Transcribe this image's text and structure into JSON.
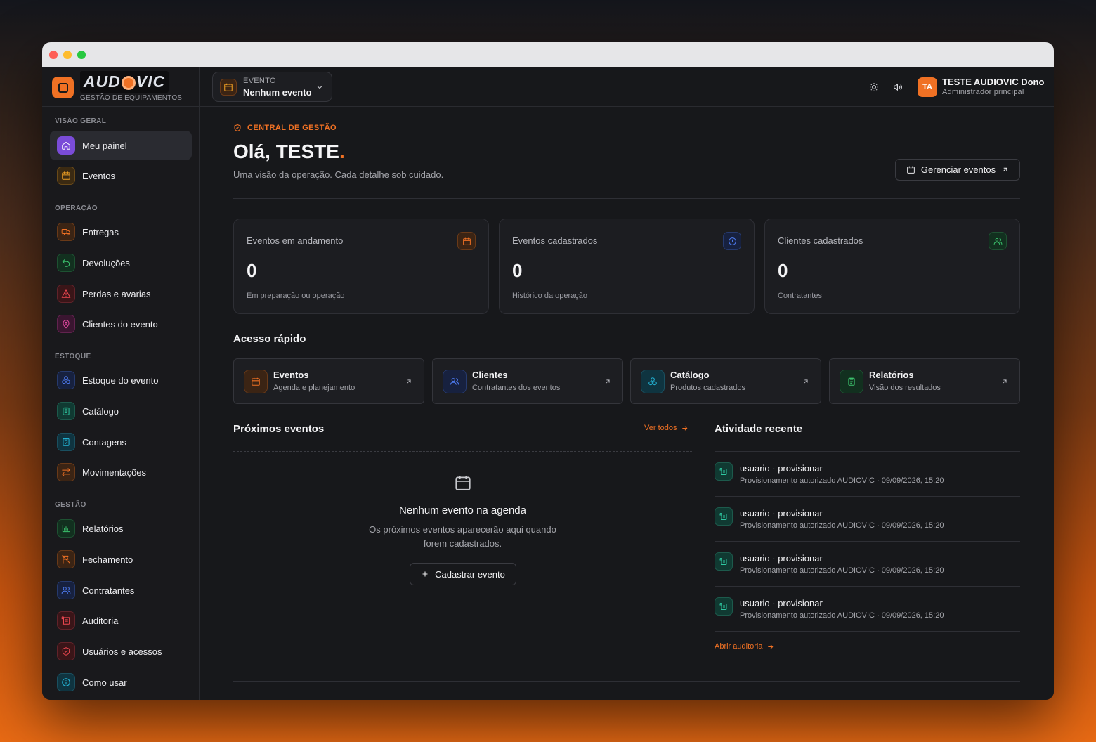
{
  "brand": {
    "logo_text": "AUDIOVIC",
    "subtitle": "GESTÃO DE EQUIPAMENTOS"
  },
  "sidebar": {
    "sections": [
      {
        "label": "VISÃO GERAL",
        "items": [
          {
            "label": "Meu painel",
            "icon": "home-icon",
            "active": true
          },
          {
            "label": "Eventos",
            "icon": "calendar-icon"
          }
        ]
      },
      {
        "label": "OPERAÇÃO",
        "items": [
          {
            "label": "Entregas",
            "icon": "truck-icon"
          },
          {
            "label": "Devoluções",
            "icon": "undo-icon"
          },
          {
            "label": "Perdas e avarias",
            "icon": "warning-icon"
          },
          {
            "label": "Clientes do evento",
            "icon": "map-pin-icon"
          }
        ]
      },
      {
        "label": "ESTOQUE",
        "items": [
          {
            "label": "Estoque do evento",
            "icon": "boxes-icon"
          },
          {
            "label": "Catálogo",
            "icon": "clipboard-icon"
          },
          {
            "label": "Contagens",
            "icon": "clipboard-check-icon"
          },
          {
            "label": "Movimentações",
            "icon": "swap-icon"
          }
        ]
      },
      {
        "label": "GESTÃO",
        "items": [
          {
            "label": "Relatórios",
            "icon": "bar-chart-icon"
          },
          {
            "label": "Fechamento",
            "icon": "flag-off-icon"
          },
          {
            "label": "Contratantes",
            "icon": "users-icon"
          },
          {
            "label": "Auditoria",
            "icon": "scroll-icon"
          },
          {
            "label": "Usuários e acessos",
            "icon": "shield-icon"
          },
          {
            "label": "Como usar",
            "icon": "info-icon"
          }
        ]
      }
    ]
  },
  "topbar": {
    "event_selector": {
      "label": "EVENTO",
      "value": "Nenhum evento"
    },
    "user": {
      "initials": "TA",
      "name": "TESTE AUDIOVIC Dono",
      "role": "Administrador principal"
    }
  },
  "header": {
    "kicker": "CENTRAL DE GESTÃO",
    "greeting": "Olá, TESTE",
    "greeting_dot": ".",
    "subtitle": "Uma visão da operação. Cada detalhe sob cuidado.",
    "manage_button": "Gerenciar eventos"
  },
  "stats": [
    {
      "title": "Eventos em andamento",
      "value": "0",
      "sub": "Em preparação ou operação",
      "icon": "calendar-icon"
    },
    {
      "title": "Eventos cadastrados",
      "value": "0",
      "sub": "Histórico da operação",
      "icon": "clock-icon"
    },
    {
      "title": "Clientes cadastrados",
      "value": "0",
      "sub": "Contratantes",
      "icon": "users-icon"
    }
  ],
  "quick_access": {
    "title": "Acesso rápido",
    "items": [
      {
        "title": "Eventos",
        "sub": "Agenda e planejamento",
        "icon": "calendar-icon"
      },
      {
        "title": "Clientes",
        "sub": "Contratantes dos eventos",
        "icon": "users-icon"
      },
      {
        "title": "Catálogo",
        "sub": "Produtos cadastrados",
        "icon": "boxes-icon"
      },
      {
        "title": "Relatórios",
        "sub": "Visão dos resultados",
        "icon": "clipboard-icon"
      }
    ]
  },
  "upcoming": {
    "title": "Próximos eventos",
    "see_all": "Ver todos",
    "empty_title": "Nenhum evento na agenda",
    "empty_sub": "Os próximos eventos aparecerão aqui quando forem cadastrados.",
    "add_button": "Cadastrar evento"
  },
  "activity": {
    "title": "Atividade recente",
    "items": [
      {
        "title": "usuario · provisionar",
        "sub": "Provisionamento autorizado AUDIOVIC · 09/09/2026, 15:20"
      },
      {
        "title": "usuario · provisionar",
        "sub": "Provisionamento autorizado AUDIOVIC · 09/09/2026, 15:20"
      },
      {
        "title": "usuario · provisionar",
        "sub": "Provisionamento autorizado AUDIOVIC · 09/09/2026, 15:20"
      },
      {
        "title": "usuario · provisionar",
        "sub": "Provisionamento autorizado AUDIOVIC · 09/09/2026, 15:20"
      }
    ],
    "open_audit": "Abrir auditoria"
  },
  "colors": {
    "accent": "#f07124",
    "background": "#17181b",
    "sidebar": "#19191c"
  }
}
